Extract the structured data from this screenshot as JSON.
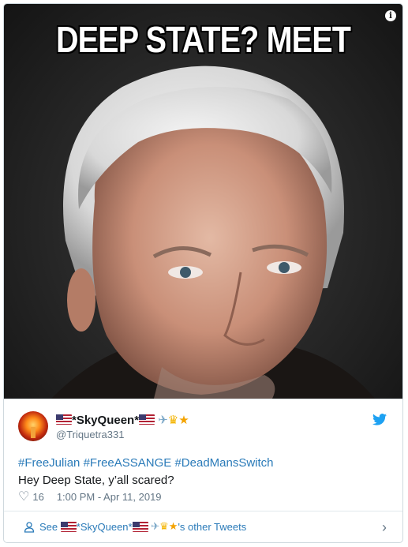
{
  "meme": {
    "caption": "DEEP STATE? MEET"
  },
  "tweet": {
    "display_name_prefix": "*SkyQueen*",
    "handle": "@Triquetra331",
    "hashtags": [
      "#FreeJulian",
      "#FreeASSANGE",
      "#DeadMansSwitch"
    ],
    "text": "Hey Deep State, y’all scared?",
    "likes": "16",
    "timestamp": "1:00 PM - Apr 11, 2019"
  },
  "footer": {
    "see_label": "See",
    "name": "*SkyQueen*",
    "suffix": "'s other Tweets"
  },
  "icons": {
    "info": "info-icon",
    "bird": "twitter-bird-icon",
    "heart": "heart-icon",
    "person": "person-icon",
    "chevron": "chevron-right-icon"
  },
  "colors": {
    "link": "#2b7bb9",
    "brand": "#1da1f2",
    "muted": "#657786"
  }
}
